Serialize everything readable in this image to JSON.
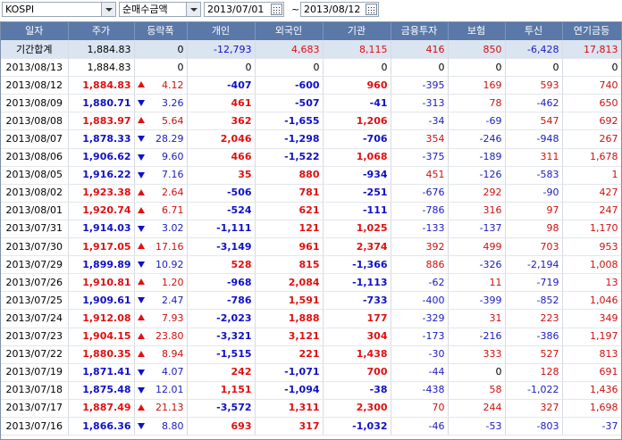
{
  "toolbar": {
    "market": "KOSPI",
    "metric": "순매수금액",
    "date_from": "2013/07/01",
    "date_sep": "~",
    "date_to": "2013/08/12"
  },
  "columns": [
    "일자",
    "주가",
    "등락폭",
    "개인",
    "외국인",
    "기관",
    "금융투자",
    "보험",
    "투신",
    "연기금등"
  ],
  "summary": {
    "label": "기간합계",
    "price": "1,884.83",
    "change": "0",
    "indiv": "-12,793",
    "foreign": "4,683",
    "inst": "8,115",
    "fin": "416",
    "ins": "850",
    "trust": "-6,428",
    "pension": "17,813"
  },
  "rows": [
    {
      "date": "2013/08/13",
      "price": "1,884.83",
      "dir": "none",
      "change": "0",
      "indiv": "0",
      "foreign": "0",
      "inst": "0",
      "fin": "0",
      "ins": "0",
      "trust": "0",
      "pension": "0"
    },
    {
      "date": "2013/08/12",
      "price": "1,884.83",
      "dir": "up",
      "change": "4.12",
      "indiv": "-407",
      "foreign": "-600",
      "inst": "960",
      "fin": "-395",
      "ins": "169",
      "trust": "593",
      "pension": "740"
    },
    {
      "date": "2013/08/09",
      "price": "1,880.71",
      "dir": "down",
      "change": "3.26",
      "indiv": "461",
      "foreign": "-507",
      "inst": "-41",
      "fin": "-313",
      "ins": "78",
      "trust": "-462",
      "pension": "650"
    },
    {
      "date": "2013/08/08",
      "price": "1,883.97",
      "dir": "up",
      "change": "5.64",
      "indiv": "362",
      "foreign": "-1,655",
      "inst": "1,206",
      "fin": "-34",
      "ins": "-69",
      "trust": "547",
      "pension": "692"
    },
    {
      "date": "2013/08/07",
      "price": "1,878.33",
      "dir": "down",
      "change": "28.29",
      "indiv": "2,046",
      "foreign": "-1,298",
      "inst": "-706",
      "fin": "354",
      "ins": "-246",
      "trust": "-948",
      "pension": "267"
    },
    {
      "date": "2013/08/06",
      "price": "1,906.62",
      "dir": "down",
      "change": "9.60",
      "indiv": "466",
      "foreign": "-1,522",
      "inst": "1,068",
      "fin": "-375",
      "ins": "-189",
      "trust": "311",
      "pension": "1,678"
    },
    {
      "date": "2013/08/05",
      "price": "1,916.22",
      "dir": "down",
      "change": "7.16",
      "indiv": "35",
      "foreign": "880",
      "inst": "-934",
      "fin": "451",
      "ins": "-126",
      "trust": "-583",
      "pension": "1"
    },
    {
      "date": "2013/08/02",
      "price": "1,923.38",
      "dir": "up",
      "change": "2.64",
      "indiv": "-506",
      "foreign": "781",
      "inst": "-251",
      "fin": "-676",
      "ins": "292",
      "trust": "-90",
      "pension": "427"
    },
    {
      "date": "2013/08/01",
      "price": "1,920.74",
      "dir": "up",
      "change": "6.71",
      "indiv": "-524",
      "foreign": "621",
      "inst": "-111",
      "fin": "-786",
      "ins": "316",
      "trust": "97",
      "pension": "247"
    },
    {
      "date": "2013/07/31",
      "price": "1,914.03",
      "dir": "down",
      "change": "3.02",
      "indiv": "-1,111",
      "foreign": "121",
      "inst": "1,025",
      "fin": "-133",
      "ins": "-137",
      "trust": "98",
      "pension": "1,170"
    },
    {
      "date": "2013/07/30",
      "price": "1,917.05",
      "dir": "up",
      "change": "17.16",
      "indiv": "-3,149",
      "foreign": "961",
      "inst": "2,374",
      "fin": "392",
      "ins": "499",
      "trust": "703",
      "pension": "953"
    },
    {
      "date": "2013/07/29",
      "price": "1,899.89",
      "dir": "down",
      "change": "10.92",
      "indiv": "528",
      "foreign": "815",
      "inst": "-1,366",
      "fin": "886",
      "ins": "-326",
      "trust": "-2,194",
      "pension": "1,008"
    },
    {
      "date": "2013/07/26",
      "price": "1,910.81",
      "dir": "up",
      "change": "1.20",
      "indiv": "-968",
      "foreign": "2,084",
      "inst": "-1,113",
      "fin": "-62",
      "ins": "11",
      "trust": "-719",
      "pension": "13"
    },
    {
      "date": "2013/07/25",
      "price": "1,909.61",
      "dir": "down",
      "change": "2.47",
      "indiv": "-786",
      "foreign": "1,591",
      "inst": "-733",
      "fin": "-400",
      "ins": "-399",
      "trust": "-852",
      "pension": "1,046"
    },
    {
      "date": "2013/07/24",
      "price": "1,912.08",
      "dir": "up",
      "change": "7.93",
      "indiv": "-2,023",
      "foreign": "1,888",
      "inst": "177",
      "fin": "-329",
      "ins": "31",
      "trust": "223",
      "pension": "349"
    },
    {
      "date": "2013/07/23",
      "price": "1,904.15",
      "dir": "up",
      "change": "23.80",
      "indiv": "-3,321",
      "foreign": "3,121",
      "inst": "304",
      "fin": "-173",
      "ins": "-216",
      "trust": "-386",
      "pension": "1,197"
    },
    {
      "date": "2013/07/22",
      "price": "1,880.35",
      "dir": "up",
      "change": "8.94",
      "indiv": "-1,515",
      "foreign": "221",
      "inst": "1,438",
      "fin": "-30",
      "ins": "333",
      "trust": "527",
      "pension": "813"
    },
    {
      "date": "2013/07/19",
      "price": "1,871.41",
      "dir": "down",
      "change": "4.07",
      "indiv": "242",
      "foreign": "-1,071",
      "inst": "700",
      "fin": "-44",
      "ins": "0",
      "trust": "128",
      "pension": "691"
    },
    {
      "date": "2013/07/18",
      "price": "1,875.48",
      "dir": "down",
      "change": "12.01",
      "indiv": "1,151",
      "foreign": "-1,094",
      "inst": "-38",
      "fin": "-438",
      "ins": "58",
      "trust": "-1,022",
      "pension": "1,436"
    },
    {
      "date": "2013/07/17",
      "price": "1,887.49",
      "dir": "up",
      "change": "21.13",
      "indiv": "-3,572",
      "foreign": "1,311",
      "inst": "2,300",
      "fin": "70",
      "ins": "244",
      "trust": "327",
      "pension": "1,698"
    },
    {
      "date": "2013/07/16",
      "price": "1,866.36",
      "dir": "down",
      "change": "8.80",
      "indiv": "693",
      "foreign": "317",
      "inst": "-1,032",
      "fin": "-46",
      "ins": "-53",
      "trust": "-803",
      "pension": "-37"
    }
  ]
}
